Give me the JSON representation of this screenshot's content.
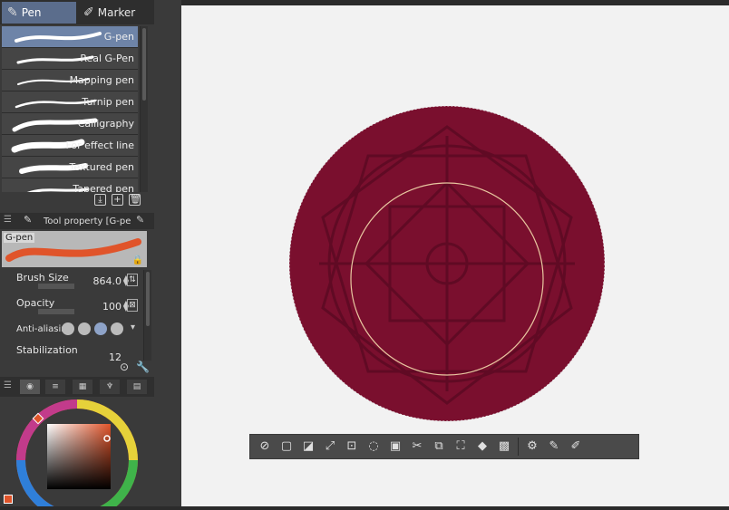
{
  "tabs": [
    {
      "label": "Pen",
      "icon": "pen-icon",
      "active": true
    },
    {
      "label": "Marker",
      "icon": "marker-icon",
      "active": false
    }
  ],
  "brushes": [
    {
      "label": "G-pen",
      "selected": true
    },
    {
      "label": "Real G-Pen"
    },
    {
      "label": "Mapping pen"
    },
    {
      "label": "Turnip pen"
    },
    {
      "label": "Calligraphy"
    },
    {
      "label": "For effect line"
    },
    {
      "label": "Textured pen"
    },
    {
      "label": "Tapered pen"
    }
  ],
  "tool_property": {
    "title": "Tool property [G-pe",
    "preview_name": "G-pen",
    "brush_size_label": "Brush Size",
    "brush_size_value": "864.0",
    "opacity_label": "Opacity",
    "opacity_value": "100",
    "anti_aliasing_label": "Anti-aliasing",
    "stabilization_label": "Stabilization",
    "stabilization_value": "12"
  },
  "colors": {
    "accent_tab": "#5b6d8c",
    "selected_item": "#6e84a8",
    "circle_fill": "#7a0f2e",
    "swatch": "#e0542a"
  },
  "toolbar_icons": [
    "deselect-icon",
    "crop-icon",
    "invert-selection-icon",
    "expand-selection-icon",
    "shrink-selection-icon",
    "select-layer-icon",
    "fill-selection-icon",
    "cut-icon",
    "copy-paste-icon",
    "transform-icon",
    "fill-icon",
    "tone-icon",
    "selection-settings-icon",
    "pencil-icon",
    "edit-icon"
  ]
}
